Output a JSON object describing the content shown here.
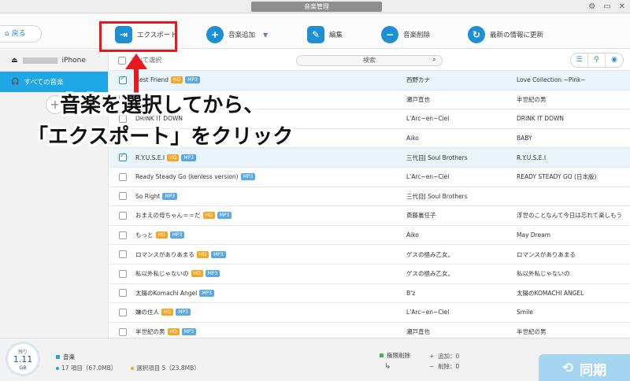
{
  "window": {
    "title": "音楽管理"
  },
  "toolbar": {
    "back_label": "戻る",
    "items": [
      {
        "label": "エクスポート",
        "icon": "export-icon"
      },
      {
        "label": "音楽追加",
        "icon": "add-music-icon"
      },
      {
        "label": "編集",
        "icon": "edit-icon"
      },
      {
        "label": "音楽削除",
        "icon": "delete-music-icon"
      },
      {
        "label": "最新の情報に更新",
        "icon": "refresh-icon"
      }
    ]
  },
  "sidebar": {
    "device_name": "iPhone",
    "nav_active": "すべての音楽",
    "add_symbol": "+"
  },
  "list": {
    "select_all_label": "すべて選択",
    "search_placeholder": "検索",
    "rows": [
      {
        "title": "Best Friend",
        "badges": [
          "HQ",
          "MP3"
        ],
        "artist": "西野カナ",
        "album": "Love Collection ~Pink~",
        "checked": true
      },
      {
        "title": "",
        "badges": [],
        "artist": "瀬戸直也",
        "album": "半世紀の男",
        "checked": false
      },
      {
        "title": "DRINK IT DOWN",
        "badges": [],
        "artist": "L'Arc~en~Ciel",
        "album": "DRINK IT DOWN",
        "checked": false
      },
      {
        "title": "",
        "badges": [],
        "artist": "Aiko",
        "album": "BABY",
        "checked": false
      },
      {
        "title": "R.Y.U.S.E.I",
        "badges": [
          "HQ",
          "MP3"
        ],
        "artist": "三代目J Soul Brothers",
        "album": "R.Y.U.S.E.I",
        "checked": true
      },
      {
        "title": "Ready Steady Go (kenless version)",
        "badges": [
          "MP3"
        ],
        "artist": "L'Arc~en~Ciel",
        "album": "READY STEADY GO (日本版)",
        "checked": false
      },
      {
        "title": "So Right",
        "badges": [
          "MP3"
        ],
        "artist": "三代目J Soul Brothers",
        "album": "",
        "checked": false
      },
      {
        "title": "おまえの母ちゃん＝＝だ",
        "badges": [
          "HQ",
          "MP3"
        ],
        "artist": "斎藤裏任子",
        "album": "浮世のことなんて今日は忘れて楽しもう",
        "checked": false
      },
      {
        "title": "もっと",
        "badges": [
          "HQ",
          "MP3"
        ],
        "artist": "Aiko",
        "album": "May Dream",
        "checked": false
      },
      {
        "title": "ロマンスがありあまる",
        "badges": [
          "HQ",
          "MP3"
        ],
        "artist": "ゲスの極み乙女。",
        "album": "ロマンスがありあまる",
        "checked": false
      },
      {
        "title": "私以外私じゃないの",
        "badges": [
          "HQ",
          "MP3"
        ],
        "artist": "ゲスの極み乙女。",
        "album": "私以外私じゃないの",
        "checked": false
      },
      {
        "title": "太陽のKomachi Angel",
        "badges": [
          "MP3"
        ],
        "artist": "B'z",
        "album": "太陽のKOMACHI ANGEL",
        "checked": false
      },
      {
        "title": "嫌の住人",
        "badges": [
          "HQ",
          "MP3"
        ],
        "artist": "L'Arc~en~Ciel",
        "album": "Smile",
        "checked": false
      },
      {
        "title": "半世紀の男",
        "badges": [
          "HQ",
          "MP3"
        ],
        "artist": "瀬戸直也",
        "album": "半世紀の男",
        "checked": false
      }
    ]
  },
  "annotation": {
    "line1": "音楽を選択してから、",
    "line2": "「エクスポート」をクリック",
    "color": "#e8191e"
  },
  "footer": {
    "storage_label": "残り",
    "storage_value": "1.11",
    "storage_unit": "GB",
    "legend_label": "音楽",
    "total_items": "17 項目（67.0MB）",
    "selected_items": "選択項目 5（23.8MB）",
    "delete_label": "権限削除",
    "add_count": "追加：0",
    "delete_count": "削除：0",
    "sync_label": "同期"
  },
  "colors": {
    "accent": "#1d8fd2",
    "highlight_row": "#e9f5fb",
    "sync_button": "#a6d5f1",
    "badge_hq": "#f5a623",
    "badge_mp3": "#5aa9e6"
  }
}
